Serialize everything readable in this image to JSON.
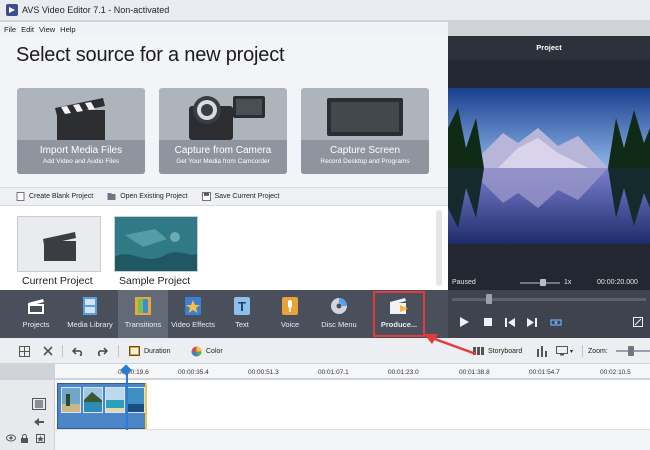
{
  "window": {
    "title": "AVS Video Editor 7.1 - Non-activated"
  },
  "menu": [
    "File",
    "Edit",
    "View",
    "Help"
  ],
  "source": {
    "title": "Select source for a new project",
    "tiles": [
      {
        "title": "Import Media Files",
        "subtitle": "Add Video and Audio Files"
      },
      {
        "title": "Capture from Camera",
        "subtitle": "Get Your Media from Camcorder"
      },
      {
        "title": "Capture Screen",
        "subtitle": "Record Desktop and Programs"
      }
    ]
  },
  "project_actions": [
    "Create Blank Project",
    "Open Existing Project",
    "Save Current Project"
  ],
  "projects": [
    {
      "label": "Current Project"
    },
    {
      "label": "Sample Project"
    }
  ],
  "preview": {
    "header": "Project",
    "status": "Paused",
    "speed": "1x",
    "time": "00:00:20.000"
  },
  "toolbar": {
    "items": [
      {
        "label": "Projects",
        "icon": "clapper-icon"
      },
      {
        "label": "Media Library",
        "icon": "film-icon"
      },
      {
        "label": "Transitions",
        "icon": "transition-icon"
      },
      {
        "label": "Video Effects",
        "icon": "star-film-icon"
      },
      {
        "label": "Text",
        "icon": "text-icon"
      },
      {
        "label": "Voice",
        "icon": "microphone-icon"
      },
      {
        "label": "Disc Menu",
        "icon": "disc-icon"
      },
      {
        "label": "Produce...",
        "icon": "produce-icon"
      }
    ],
    "active": "Transitions",
    "highlighted": "Produce..."
  },
  "timeline_toolbar": {
    "duration": "Duration",
    "color": "Color",
    "storyboard": "Storyboard",
    "zoom": "Zoom:"
  },
  "ruler": {
    "labels": [
      "00:00:19.6",
      "00:00:35.4",
      "00:00:51.3",
      "00:01:07.1",
      "00:01:23.0",
      "00:01:38.8",
      "00:01:54.7",
      "00:02:10.5"
    ]
  },
  "colors": {
    "toolbar_bg": "#4a505b",
    "highlight": "#e23b3b",
    "clip": "#4d86c8",
    "playhead": "#2a7ad8"
  }
}
